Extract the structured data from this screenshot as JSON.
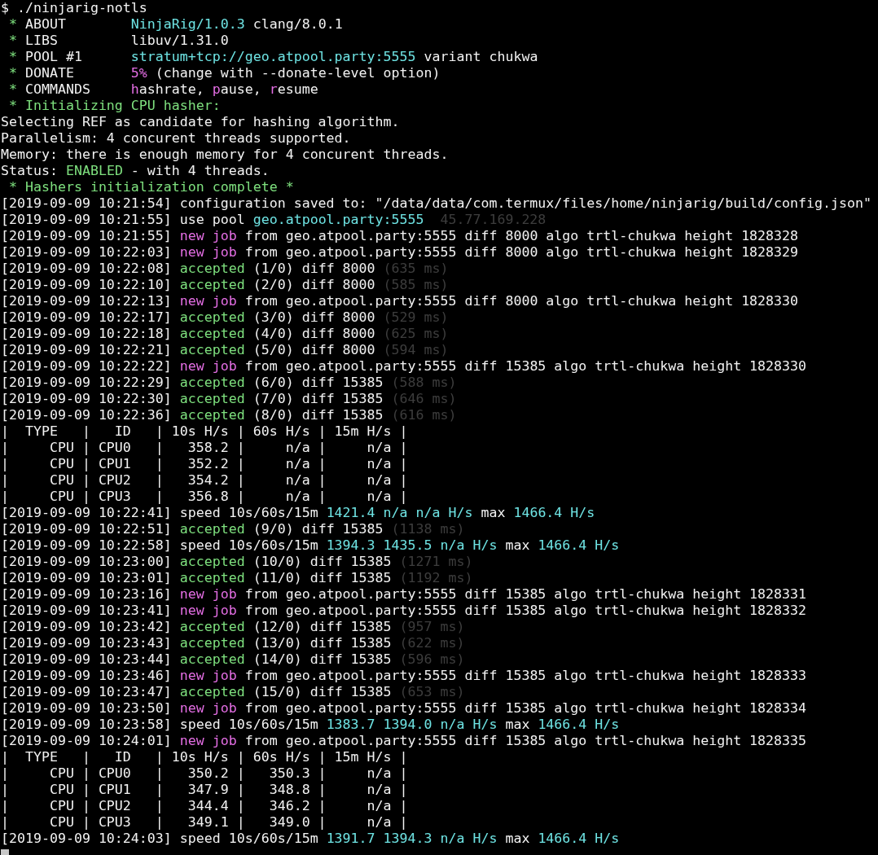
{
  "terminal": {
    "lines": [
      {
        "segments": [
          {
            "text": "$ ./ninjarig-notls"
          }
        ]
      },
      {
        "segments": [
          {
            "text": " * ",
            "kind": "green"
          },
          {
            "text": "ABOUT        "
          },
          {
            "text": "NinjaRig/1.0.3",
            "kind": "cyan"
          },
          {
            "text": " clang/8.0.1"
          }
        ]
      },
      {
        "segments": [
          {
            "text": " * ",
            "kind": "green"
          },
          {
            "text": "LIBS         libuv/1.31.0"
          }
        ]
      },
      {
        "segments": [
          {
            "text": " * ",
            "kind": "green"
          },
          {
            "text": "POOL #1      "
          },
          {
            "text": "stratum+tcp://geo.atpool.party:5555",
            "kind": "cyan"
          },
          {
            "text": " variant chukwa"
          }
        ]
      },
      {
        "segments": [
          {
            "text": " * ",
            "kind": "green"
          },
          {
            "text": "DONATE       "
          },
          {
            "text": "5%",
            "kind": "magenta"
          },
          {
            "text": " (change with --donate-level option)"
          }
        ]
      },
      {
        "segments": [
          {
            "text": " * ",
            "kind": "green"
          },
          {
            "text": "COMMANDS     "
          },
          {
            "text": "h",
            "kind": "magenta"
          },
          {
            "text": "ashrate, "
          },
          {
            "text": "p",
            "kind": "magenta"
          },
          {
            "text": "ause, "
          },
          {
            "text": "r",
            "kind": "magenta"
          },
          {
            "text": "esume"
          }
        ]
      },
      {
        "segments": [
          {
            "text": " * Initializing CPU hasher:",
            "kind": "green"
          }
        ]
      },
      {
        "segments": [
          {
            "text": "Selecting REF as candidate for hashing algorithm."
          }
        ]
      },
      {
        "segments": [
          {
            "text": "Parallelism: 4 concurent threads supported."
          }
        ]
      },
      {
        "segments": [
          {
            "text": "Memory: there is enough memory for 4 concurent threads."
          }
        ]
      },
      {
        "segments": [
          {
            "text": "Status: "
          },
          {
            "text": "ENABLED",
            "kind": "green"
          },
          {
            "text": " - with 4 threads."
          }
        ]
      },
      {
        "segments": [
          {
            "text": " * Hashers initialization complete *",
            "kind": "green"
          }
        ]
      },
      {
        "segments": [
          {
            "text": "[2019-09-09 10:21:54] configuration saved to: \"/data/data/com.termux/files/home/ninjarig/build/config.json\""
          }
        ]
      },
      {
        "segments": [
          {
            "text": "[2019-09-09 10:21:55] use pool "
          },
          {
            "text": "geo.atpool.party:5555",
            "kind": "cyan"
          },
          {
            "text": "  45.77.169.228",
            "kind": "dim"
          }
        ]
      },
      {
        "segments": [
          {
            "text": "[2019-09-09 10:21:55] "
          },
          {
            "text": "new job",
            "kind": "magenta"
          },
          {
            "text": " from geo.atpool.party:5555 diff 8000 algo trtl-chukwa height 1828328"
          }
        ]
      },
      {
        "segments": [
          {
            "text": "[2019-09-09 10:22:03] "
          },
          {
            "text": "new job",
            "kind": "magenta"
          },
          {
            "text": " from geo.atpool.party:5555 diff 8000 algo trtl-chukwa height 1828329"
          }
        ]
      },
      {
        "segments": [
          {
            "text": "[2019-09-09 10:22:08] "
          },
          {
            "text": "accepted",
            "kind": "green"
          },
          {
            "text": " (1/0) diff 8000 "
          },
          {
            "text": "(635 ms)",
            "kind": "dim"
          }
        ]
      },
      {
        "segments": [
          {
            "text": "[2019-09-09 10:22:10] "
          },
          {
            "text": "accepted",
            "kind": "green"
          },
          {
            "text": " (2/0) diff 8000 "
          },
          {
            "text": "(585 ms)",
            "kind": "dim"
          }
        ]
      },
      {
        "segments": [
          {
            "text": "[2019-09-09 10:22:13] "
          },
          {
            "text": "new job",
            "kind": "magenta"
          },
          {
            "text": " from geo.atpool.party:5555 diff 8000 algo trtl-chukwa height 1828330"
          }
        ]
      },
      {
        "segments": [
          {
            "text": "[2019-09-09 10:22:17] "
          },
          {
            "text": "accepted",
            "kind": "green"
          },
          {
            "text": " (3/0) diff 8000 "
          },
          {
            "text": "(529 ms)",
            "kind": "dim"
          }
        ]
      },
      {
        "segments": [
          {
            "text": "[2019-09-09 10:22:18] "
          },
          {
            "text": "accepted",
            "kind": "green"
          },
          {
            "text": " (4/0) diff 8000 "
          },
          {
            "text": "(625 ms)",
            "kind": "dim"
          }
        ]
      },
      {
        "segments": [
          {
            "text": "[2019-09-09 10:22:21] "
          },
          {
            "text": "accepted",
            "kind": "green"
          },
          {
            "text": " (5/0) diff 8000 "
          },
          {
            "text": "(594 ms)",
            "kind": "dim"
          }
        ]
      },
      {
        "segments": [
          {
            "text": "[2019-09-09 10:22:22] "
          },
          {
            "text": "new job",
            "kind": "magenta"
          },
          {
            "text": " from geo.atpool.party:5555 diff 15385 algo trtl-chukwa height 1828330"
          }
        ]
      },
      {
        "segments": [
          {
            "text": "[2019-09-09 10:22:29] "
          },
          {
            "text": "accepted",
            "kind": "green"
          },
          {
            "text": " (6/0) diff 15385 "
          },
          {
            "text": "(588 ms)",
            "kind": "dim"
          }
        ]
      },
      {
        "segments": [
          {
            "text": "[2019-09-09 10:22:30] "
          },
          {
            "text": "accepted",
            "kind": "green"
          },
          {
            "text": " (7/0) diff 15385 "
          },
          {
            "text": "(646 ms)",
            "kind": "dim"
          }
        ]
      },
      {
        "segments": [
          {
            "text": "[2019-09-09 10:22:36] "
          },
          {
            "text": "accepted",
            "kind": "green"
          },
          {
            "text": " (8/0) diff 15385 "
          },
          {
            "text": "(616 ms)",
            "kind": "dim"
          }
        ]
      },
      {
        "segments": [
          {
            "text": "|  TYPE   |   ID   | 10s H/s | 60s H/s | 15m H/s |"
          }
        ]
      },
      {
        "segments": [
          {
            "text": "|     CPU | CPU0   |   358.2 |     n/a |     n/a |"
          }
        ]
      },
      {
        "segments": [
          {
            "text": "|     CPU | CPU1   |   352.2 |     n/a |     n/a |"
          }
        ]
      },
      {
        "segments": [
          {
            "text": "|     CPU | CPU2   |   354.2 |     n/a |     n/a |"
          }
        ]
      },
      {
        "segments": [
          {
            "text": "|     CPU | CPU3   |   356.8 |     n/a |     n/a |"
          }
        ]
      },
      {
        "segments": [
          {
            "text": "[2019-09-09 10:22:41] speed 10s/60s/15m "
          },
          {
            "text": "1421.4 n/a n/a H/s",
            "kind": "cyan"
          },
          {
            "text": " max "
          },
          {
            "text": "1466.4 H/s",
            "kind": "cyan"
          }
        ]
      },
      {
        "segments": [
          {
            "text": "[2019-09-09 10:22:51] "
          },
          {
            "text": "accepted",
            "kind": "green"
          },
          {
            "text": " (9/0) diff 15385 "
          },
          {
            "text": "(1138 ms)",
            "kind": "dim"
          }
        ]
      },
      {
        "segments": [
          {
            "text": "[2019-09-09 10:22:58] speed 10s/60s/15m "
          },
          {
            "text": "1394.3 1435.5 n/a H/s",
            "kind": "cyan"
          },
          {
            "text": " max "
          },
          {
            "text": "1466.4 H/s",
            "kind": "cyan"
          }
        ]
      },
      {
        "segments": [
          {
            "text": "[2019-09-09 10:23:00] "
          },
          {
            "text": "accepted",
            "kind": "green"
          },
          {
            "text": " (10/0) diff 15385 "
          },
          {
            "text": "(1271 ms)",
            "kind": "dim"
          }
        ]
      },
      {
        "segments": [
          {
            "text": "[2019-09-09 10:23:01] "
          },
          {
            "text": "accepted",
            "kind": "green"
          },
          {
            "text": " (11/0) diff 15385 "
          },
          {
            "text": "(1192 ms)",
            "kind": "dim"
          }
        ]
      },
      {
        "segments": [
          {
            "text": "[2019-09-09 10:23:16] "
          },
          {
            "text": "new job",
            "kind": "magenta"
          },
          {
            "text": " from geo.atpool.party:5555 diff 15385 algo trtl-chukwa height 1828331"
          }
        ]
      },
      {
        "segments": [
          {
            "text": "[2019-09-09 10:23:41] "
          },
          {
            "text": "new job",
            "kind": "magenta"
          },
          {
            "text": " from geo.atpool.party:5555 diff 15385 algo trtl-chukwa height 1828332"
          }
        ]
      },
      {
        "segments": [
          {
            "text": "[2019-09-09 10:23:42] "
          },
          {
            "text": "accepted",
            "kind": "green"
          },
          {
            "text": " (12/0) diff 15385 "
          },
          {
            "text": "(957 ms)",
            "kind": "dim"
          }
        ]
      },
      {
        "segments": [
          {
            "text": "[2019-09-09 10:23:43] "
          },
          {
            "text": "accepted",
            "kind": "green"
          },
          {
            "text": " (13/0) diff 15385 "
          },
          {
            "text": "(622 ms)",
            "kind": "dim"
          }
        ]
      },
      {
        "segments": [
          {
            "text": "[2019-09-09 10:23:44] "
          },
          {
            "text": "accepted",
            "kind": "green"
          },
          {
            "text": " (14/0) diff 15385 "
          },
          {
            "text": "(596 ms)",
            "kind": "dim"
          }
        ]
      },
      {
        "segments": [
          {
            "text": "[2019-09-09 10:23:46] "
          },
          {
            "text": "new job",
            "kind": "magenta"
          },
          {
            "text": " from geo.atpool.party:5555 diff 15385 algo trtl-chukwa height 1828333"
          }
        ]
      },
      {
        "segments": [
          {
            "text": "[2019-09-09 10:23:47] "
          },
          {
            "text": "accepted",
            "kind": "green"
          },
          {
            "text": " (15/0) diff 15385 "
          },
          {
            "text": "(653 ms)",
            "kind": "dim"
          }
        ]
      },
      {
        "segments": [
          {
            "text": "[2019-09-09 10:23:50] "
          },
          {
            "text": "new job",
            "kind": "magenta"
          },
          {
            "text": " from geo.atpool.party:5555 diff 15385 algo trtl-chukwa height 1828334"
          }
        ]
      },
      {
        "segments": [
          {
            "text": "[2019-09-09 10:23:58] speed 10s/60s/15m "
          },
          {
            "text": "1383.7 1394.0 n/a H/s",
            "kind": "cyan"
          },
          {
            "text": " max "
          },
          {
            "text": "1466.4 H/s",
            "kind": "cyan"
          }
        ]
      },
      {
        "segments": [
          {
            "text": "[2019-09-09 10:24:01] "
          },
          {
            "text": "new job",
            "kind": "magenta"
          },
          {
            "text": " from geo.atpool.party:5555 diff 15385 algo trtl-chukwa height 1828335"
          }
        ]
      },
      {
        "segments": [
          {
            "text": "|  TYPE   |   ID   | 10s H/s | 60s H/s | 15m H/s |"
          }
        ]
      },
      {
        "segments": [
          {
            "text": "|     CPU | CPU0   |   350.2 |   350.3 |     n/a |"
          }
        ]
      },
      {
        "segments": [
          {
            "text": "|     CPU | CPU1   |   347.9 |   348.8 |     n/a |"
          }
        ]
      },
      {
        "segments": [
          {
            "text": "|     CPU | CPU2   |   344.4 |   346.2 |     n/a |"
          }
        ]
      },
      {
        "segments": [
          {
            "text": "|     CPU | CPU3   |   349.1 |   349.0 |     n/a |"
          }
        ]
      },
      {
        "segments": [
          {
            "text": "[2019-09-09 10:24:03] speed 10s/60s/15m "
          },
          {
            "text": "1391.7 1394.3 n/a H/s",
            "kind": "cyan"
          },
          {
            "text": " max "
          },
          {
            "text": "1466.4 H/s",
            "kind": "cyan"
          }
        ]
      }
    ]
  }
}
